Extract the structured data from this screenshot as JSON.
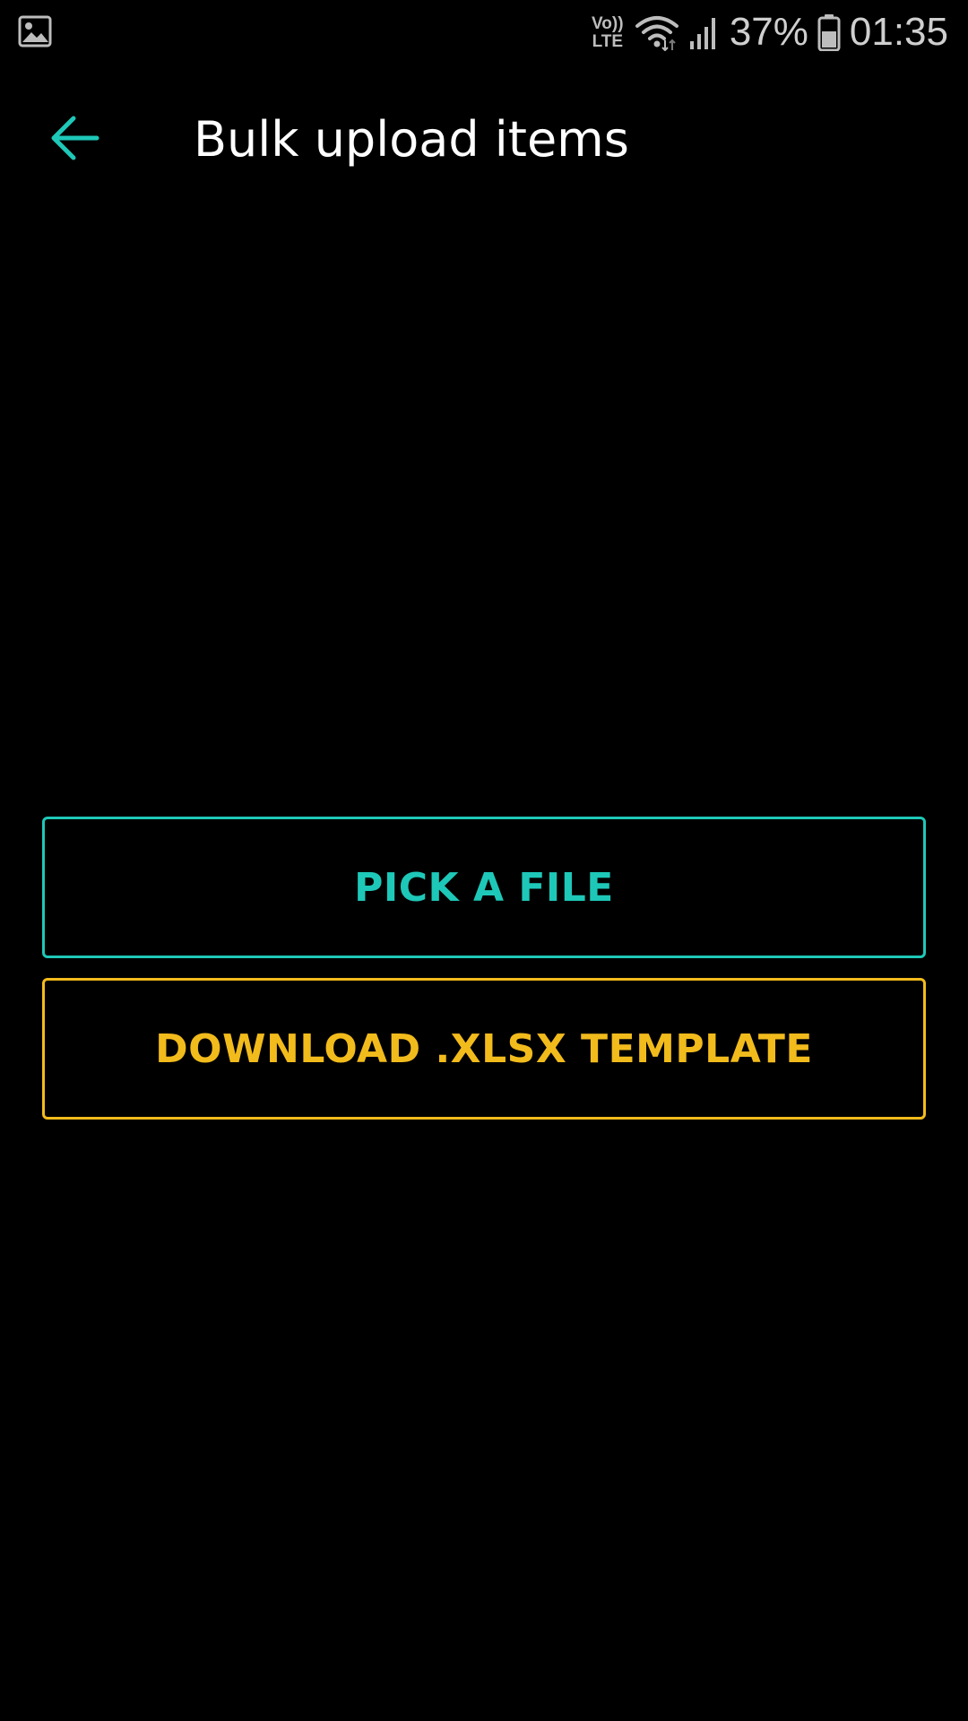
{
  "status_bar": {
    "left_icon": "gallery-notification-icon",
    "volte_line1": "Vo))",
    "volte_line2": "LTE",
    "wifi_icon": "wifi-icon",
    "signal_icon": "cell-signal-icon",
    "battery_percent": "37%",
    "battery_icon": "battery-icon",
    "time": "01:35"
  },
  "app_bar": {
    "back_icon": "arrow-left-icon",
    "title": "Bulk upload items"
  },
  "actions": {
    "pick_file_label": "PICK A FILE",
    "download_template_label": "DOWNLOAD .XLSX TEMPLATE"
  },
  "colors": {
    "background": "#000000",
    "accent_teal": "#1ec8b8",
    "accent_yellow": "#f2bb1c",
    "title_text": "#ffffff",
    "status_text": "#cfcfcf"
  }
}
